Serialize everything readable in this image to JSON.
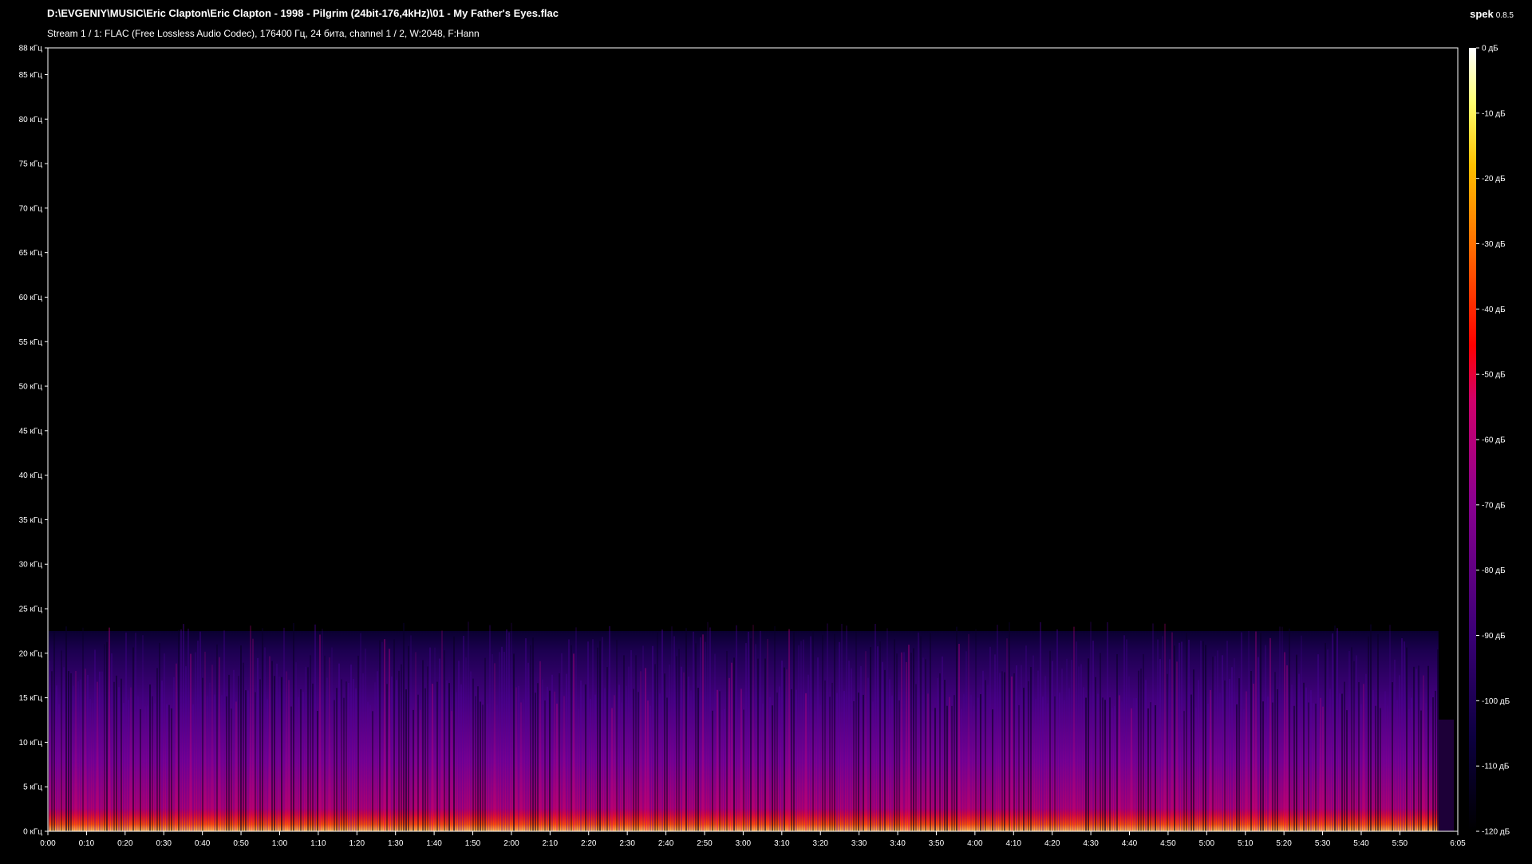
{
  "header": {
    "file_path": "D:\\EVGENIY\\MUSIC\\Eric Clapton\\Eric Clapton - 1998 - Pilgrim (24bit-176,4kHz)\\01 - My Father's Eyes.flac",
    "stream_info": "Stream 1 / 1: FLAC (Free Lossless Audio Codec), 176400 Гц, 24 бита, channel 1 / 2, W:2048, F:Hann"
  },
  "app": {
    "name": "spek",
    "version": "0.8.5"
  },
  "colors": {
    "background": "#000000",
    "axis": "#ffffff",
    "palette": [
      "#000000",
      "#1a0058",
      "#5a008e",
      "#b0007a",
      "#ff0000",
      "#ff9a00",
      "#ffff60",
      "#ffffff"
    ]
  },
  "chart_data": {
    "type": "heatmap",
    "frequency_axis": {
      "unit": "кГц",
      "range": [
        0,
        88
      ],
      "ticks": [
        "0 кГц",
        "5 кГц",
        "10 кГц",
        "15 кГц",
        "20 кГц",
        "25 кГц",
        "30 кГц",
        "35 кГц",
        "40 кГц",
        "45 кГц",
        "50 кГц",
        "55 кГц",
        "60 кГц",
        "65 кГц",
        "70 кГц",
        "75 кГц",
        "80 кГц",
        "85 кГц",
        "88 кГц"
      ],
      "tick_values": [
        0,
        5,
        10,
        15,
        20,
        25,
        30,
        35,
        40,
        45,
        50,
        55,
        60,
        65,
        70,
        75,
        80,
        85,
        88
      ]
    },
    "time_axis": {
      "range_seconds": [
        0,
        365
      ],
      "ticks": [
        "0:00",
        "0:10",
        "0:20",
        "0:30",
        "0:40",
        "0:50",
        "1:00",
        "1:10",
        "1:20",
        "1:30",
        "1:40",
        "1:50",
        "2:00",
        "2:10",
        "2:20",
        "2:30",
        "2:40",
        "2:50",
        "3:00",
        "3:10",
        "3:20",
        "3:30",
        "3:40",
        "3:50",
        "4:00",
        "4:10",
        "4:20",
        "4:30",
        "4:40",
        "4:50",
        "5:00",
        "5:10",
        "5:20",
        "5:30",
        "5:40",
        "5:50",
        "6:05"
      ],
      "tick_values": [
        0,
        10,
        20,
        30,
        40,
        50,
        60,
        70,
        80,
        90,
        100,
        110,
        120,
        130,
        140,
        150,
        160,
        170,
        180,
        190,
        200,
        210,
        220,
        230,
        240,
        250,
        260,
        270,
        280,
        290,
        300,
        310,
        320,
        330,
        340,
        350,
        365
      ]
    },
    "level_axis": {
      "unit": "дБ",
      "range": [
        -120,
        0
      ],
      "ticks": [
        "0 дБ",
        "-10 дБ",
        "-20 дБ",
        "-30 дБ",
        "-40 дБ",
        "-50 дБ",
        "-60 дБ",
        "-70 дБ",
        "-80 дБ",
        "-90 дБ",
        "-100 дБ",
        "-110 дБ",
        "-120 дБ"
      ],
      "tick_values": [
        0,
        -10,
        -20,
        -30,
        -40,
        -50,
        -60,
        -70,
        -80,
        -90,
        -100,
        -110,
        -120
      ]
    },
    "content_cutoff_khz": 22.5
  }
}
